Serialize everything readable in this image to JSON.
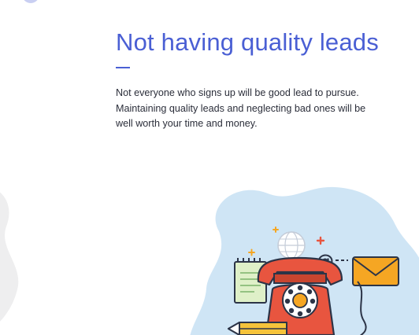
{
  "section": {
    "title": "Not having quality leads",
    "body": "Not everyone who signs up will be good lead to pursue.\nMaintaining quality leads and neglecting bad ones will be\nwell worth your time and money."
  },
  "illustration": {
    "icons": [
      "blob-background",
      "globe-icon",
      "at-sign-icon",
      "envelope-icon",
      "notepad-icon",
      "rotary-phone-icon",
      "pencil-icon",
      "sparkle-icon"
    ]
  },
  "colors": {
    "accent": "#4a5fd4",
    "body_text": "#2b2e3a",
    "blob_blue": "#cfe5f5",
    "blob_gray": "#eeeeef",
    "dot_topleft": "#c9cff2",
    "phone_red": "#e8553f",
    "envelope_orange": "#f5a623",
    "notepad_green": "#dff0c8",
    "outline": "#2c3447"
  }
}
